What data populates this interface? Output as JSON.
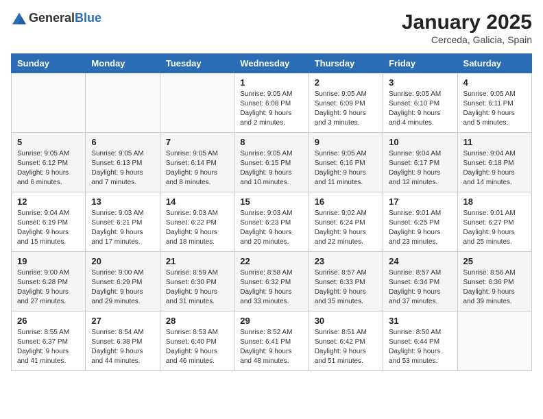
{
  "header": {
    "logo_general": "General",
    "logo_blue": "Blue",
    "month": "January 2025",
    "location": "Cerceda, Galicia, Spain"
  },
  "weekdays": [
    "Sunday",
    "Monday",
    "Tuesday",
    "Wednesday",
    "Thursday",
    "Friday",
    "Saturday"
  ],
  "weeks": [
    [
      {
        "day": "",
        "info": ""
      },
      {
        "day": "",
        "info": ""
      },
      {
        "day": "",
        "info": ""
      },
      {
        "day": "1",
        "info": "Sunrise: 9:05 AM\nSunset: 6:08 PM\nDaylight: 9 hours and 2 minutes."
      },
      {
        "day": "2",
        "info": "Sunrise: 9:05 AM\nSunset: 6:09 PM\nDaylight: 9 hours and 3 minutes."
      },
      {
        "day": "3",
        "info": "Sunrise: 9:05 AM\nSunset: 6:10 PM\nDaylight: 9 hours and 4 minutes."
      },
      {
        "day": "4",
        "info": "Sunrise: 9:05 AM\nSunset: 6:11 PM\nDaylight: 9 hours and 5 minutes."
      }
    ],
    [
      {
        "day": "5",
        "info": "Sunrise: 9:05 AM\nSunset: 6:12 PM\nDaylight: 9 hours and 6 minutes."
      },
      {
        "day": "6",
        "info": "Sunrise: 9:05 AM\nSunset: 6:13 PM\nDaylight: 9 hours and 7 minutes."
      },
      {
        "day": "7",
        "info": "Sunrise: 9:05 AM\nSunset: 6:14 PM\nDaylight: 9 hours and 8 minutes."
      },
      {
        "day": "8",
        "info": "Sunrise: 9:05 AM\nSunset: 6:15 PM\nDaylight: 9 hours and 10 minutes."
      },
      {
        "day": "9",
        "info": "Sunrise: 9:05 AM\nSunset: 6:16 PM\nDaylight: 9 hours and 11 minutes."
      },
      {
        "day": "10",
        "info": "Sunrise: 9:04 AM\nSunset: 6:17 PM\nDaylight: 9 hours and 12 minutes."
      },
      {
        "day": "11",
        "info": "Sunrise: 9:04 AM\nSunset: 6:18 PM\nDaylight: 9 hours and 14 minutes."
      }
    ],
    [
      {
        "day": "12",
        "info": "Sunrise: 9:04 AM\nSunset: 6:19 PM\nDaylight: 9 hours and 15 minutes."
      },
      {
        "day": "13",
        "info": "Sunrise: 9:03 AM\nSunset: 6:21 PM\nDaylight: 9 hours and 17 minutes."
      },
      {
        "day": "14",
        "info": "Sunrise: 9:03 AM\nSunset: 6:22 PM\nDaylight: 9 hours and 18 minutes."
      },
      {
        "day": "15",
        "info": "Sunrise: 9:03 AM\nSunset: 6:23 PM\nDaylight: 9 hours and 20 minutes."
      },
      {
        "day": "16",
        "info": "Sunrise: 9:02 AM\nSunset: 6:24 PM\nDaylight: 9 hours and 22 minutes."
      },
      {
        "day": "17",
        "info": "Sunrise: 9:01 AM\nSunset: 6:25 PM\nDaylight: 9 hours and 23 minutes."
      },
      {
        "day": "18",
        "info": "Sunrise: 9:01 AM\nSunset: 6:27 PM\nDaylight: 9 hours and 25 minutes."
      }
    ],
    [
      {
        "day": "19",
        "info": "Sunrise: 9:00 AM\nSunset: 6:28 PM\nDaylight: 9 hours and 27 minutes."
      },
      {
        "day": "20",
        "info": "Sunrise: 9:00 AM\nSunset: 6:29 PM\nDaylight: 9 hours and 29 minutes."
      },
      {
        "day": "21",
        "info": "Sunrise: 8:59 AM\nSunset: 6:30 PM\nDaylight: 9 hours and 31 minutes."
      },
      {
        "day": "22",
        "info": "Sunrise: 8:58 AM\nSunset: 6:32 PM\nDaylight: 9 hours and 33 minutes."
      },
      {
        "day": "23",
        "info": "Sunrise: 8:57 AM\nSunset: 6:33 PM\nDaylight: 9 hours and 35 minutes."
      },
      {
        "day": "24",
        "info": "Sunrise: 8:57 AM\nSunset: 6:34 PM\nDaylight: 9 hours and 37 minutes."
      },
      {
        "day": "25",
        "info": "Sunrise: 8:56 AM\nSunset: 6:36 PM\nDaylight: 9 hours and 39 minutes."
      }
    ],
    [
      {
        "day": "26",
        "info": "Sunrise: 8:55 AM\nSunset: 6:37 PM\nDaylight: 9 hours and 41 minutes."
      },
      {
        "day": "27",
        "info": "Sunrise: 8:54 AM\nSunset: 6:38 PM\nDaylight: 9 hours and 44 minutes."
      },
      {
        "day": "28",
        "info": "Sunrise: 8:53 AM\nSunset: 6:40 PM\nDaylight: 9 hours and 46 minutes."
      },
      {
        "day": "29",
        "info": "Sunrise: 8:52 AM\nSunset: 6:41 PM\nDaylight: 9 hours and 48 minutes."
      },
      {
        "day": "30",
        "info": "Sunrise: 8:51 AM\nSunset: 6:42 PM\nDaylight: 9 hours and 51 minutes."
      },
      {
        "day": "31",
        "info": "Sunrise: 8:50 AM\nSunset: 6:44 PM\nDaylight: 9 hours and 53 minutes."
      },
      {
        "day": "",
        "info": ""
      }
    ]
  ]
}
